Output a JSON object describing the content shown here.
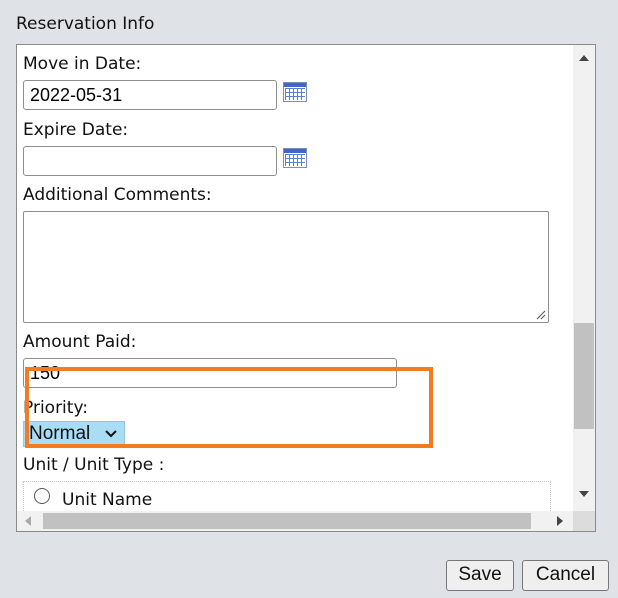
{
  "section_title": "Reservation Info",
  "fields": {
    "move_in_label": "Move in Date:",
    "move_in_value": "2022-05-31",
    "expire_label": "Expire Date:",
    "expire_value": "",
    "comments_label": "Additional Comments:",
    "amount_label": "Amount Paid:",
    "amount_value": "150",
    "priority_label": "Priority:",
    "priority_selected": "Normal",
    "unit_label": "Unit / Unit Type :",
    "unit_option": "Unit Name"
  },
  "buttons": {
    "save": "Save",
    "cancel": "Cancel"
  },
  "icons": [
    "calendar-icon",
    "chevron-down-icon",
    "scroll-up-arrow-icon",
    "scroll-down-arrow-icon",
    "scroll-left-arrow-icon",
    "scroll-right-arrow-icon",
    "resize-grip-icon"
  ],
  "colors": {
    "highlight": "#f47c20",
    "select_bg": "#a9dcf5"
  }
}
